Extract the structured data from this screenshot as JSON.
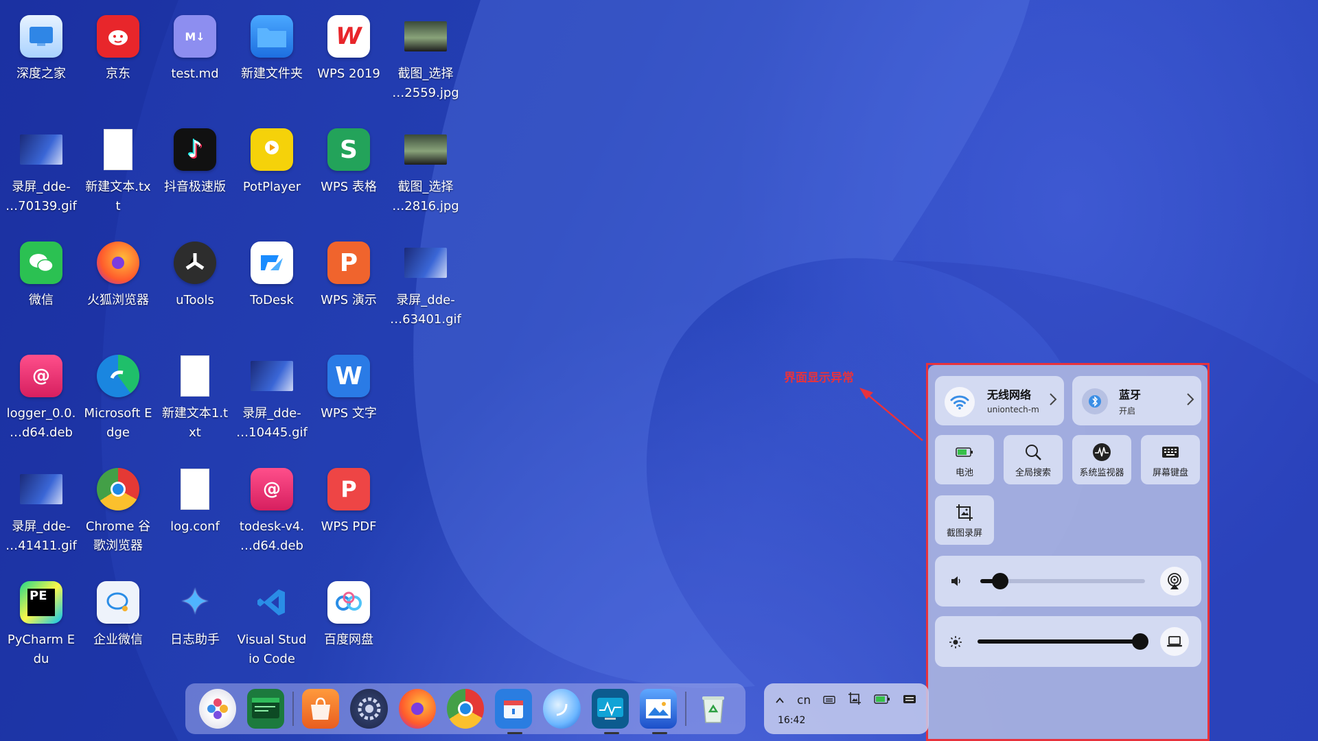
{
  "desktop": {
    "icons": [
      {
        "label": "深度之家",
        "icon": "deepin-home-icon"
      },
      {
        "label": "京东",
        "icon": "jd-icon"
      },
      {
        "label": "test.md",
        "icon": "markdown-file-icon"
      },
      {
        "label": "新建文件夹",
        "icon": "folder-icon"
      },
      {
        "label": "WPS 2019",
        "icon": "wps-icon"
      },
      {
        "label": "截图_选择\n…2559.jpg",
        "icon": "image-thumbnail-icon"
      },
      {
        "label": "录屏_dde-\n…70139.gif",
        "icon": "gif-thumbnail-icon"
      },
      {
        "label": "新建文本.tx\nt",
        "icon": "text-file-icon"
      },
      {
        "label": "抖音极速版",
        "icon": "douyin-icon"
      },
      {
        "label": "PotPlayer",
        "icon": "potplayer-icon"
      },
      {
        "label": "WPS 表格",
        "icon": "wps-sheet-icon"
      },
      {
        "label": "截图_选择\n…2816.jpg",
        "icon": "image-thumbnail-icon"
      },
      {
        "label": "微信",
        "icon": "wechat-icon"
      },
      {
        "label": "火狐浏览器",
        "icon": "firefox-icon"
      },
      {
        "label": "uTools",
        "icon": "utools-icon"
      },
      {
        "label": "ToDesk",
        "icon": "todesk-icon"
      },
      {
        "label": "WPS 演示",
        "icon": "wps-presentation-icon"
      },
      {
        "label": "录屏_dde-\n…63401.gif",
        "icon": "gif-thumbnail-icon"
      },
      {
        "label": "logger_0.0.\n…d64.deb",
        "icon": "deb-package-icon"
      },
      {
        "label": "Microsoft E\ndge",
        "icon": "edge-icon"
      },
      {
        "label": "新建文本1.t\nxt",
        "icon": "text-file-icon"
      },
      {
        "label": "录屏_dde-\n…10445.gif",
        "icon": "gif-thumbnail-icon"
      },
      {
        "label": "WPS 文字",
        "icon": "wps-writer-icon"
      },
      {
        "label": "录屏_dde-\n…41411.gif",
        "icon": "gif-thumbnail-icon"
      },
      {
        "label": "Chrome 谷\n歌浏览器",
        "icon": "chrome-icon"
      },
      {
        "label": "log.conf",
        "icon": "text-file-icon"
      },
      {
        "label": "todesk-v4.\n…d64.deb",
        "icon": "deb-package-icon"
      },
      {
        "label": "WPS PDF",
        "icon": "wps-pdf-icon"
      },
      {
        "label": "PyCharm E\ndu",
        "icon": "pycharm-icon"
      },
      {
        "label": "企业微信",
        "icon": "wecom-icon"
      },
      {
        "label": "日志助手",
        "icon": "log-assistant-icon"
      },
      {
        "label": "Visual Stud\nio Code",
        "icon": "vscode-icon"
      },
      {
        "label": "百度网盘",
        "icon": "baidu-netdisk-icon"
      }
    ]
  },
  "annotation": {
    "text": "界面显示异常",
    "color": "#e8323c"
  },
  "control_center": {
    "wifi": {
      "title": "无线网络",
      "subtitle": "uniontech-m"
    },
    "bluetooth": {
      "title": "蓝牙",
      "subtitle": "开启"
    },
    "tiles": [
      {
        "label": "电池",
        "icon": "battery-icon"
      },
      {
        "label": "全局搜索",
        "icon": "search-icon"
      },
      {
        "label": "系统监视器",
        "icon": "system-monitor-icon"
      },
      {
        "label": "屏幕键盘",
        "icon": "keyboard-icon"
      },
      {
        "label": "截图录屏",
        "icon": "screenshot-icon"
      }
    ],
    "volume": {
      "level": 0.12
    },
    "brightness": {
      "level": 0.98
    }
  },
  "dock": {
    "apps": [
      "launcher-icon",
      "terminal-icon",
      "app-store-icon",
      "settings-icon",
      "firefox-icon",
      "chrome-icon",
      "file-manager-icon",
      "browser-icon",
      "system-monitor-icon",
      "image-viewer-icon",
      "trash-icon"
    ]
  },
  "tray": {
    "ime": "cn",
    "clock": "16:42"
  }
}
